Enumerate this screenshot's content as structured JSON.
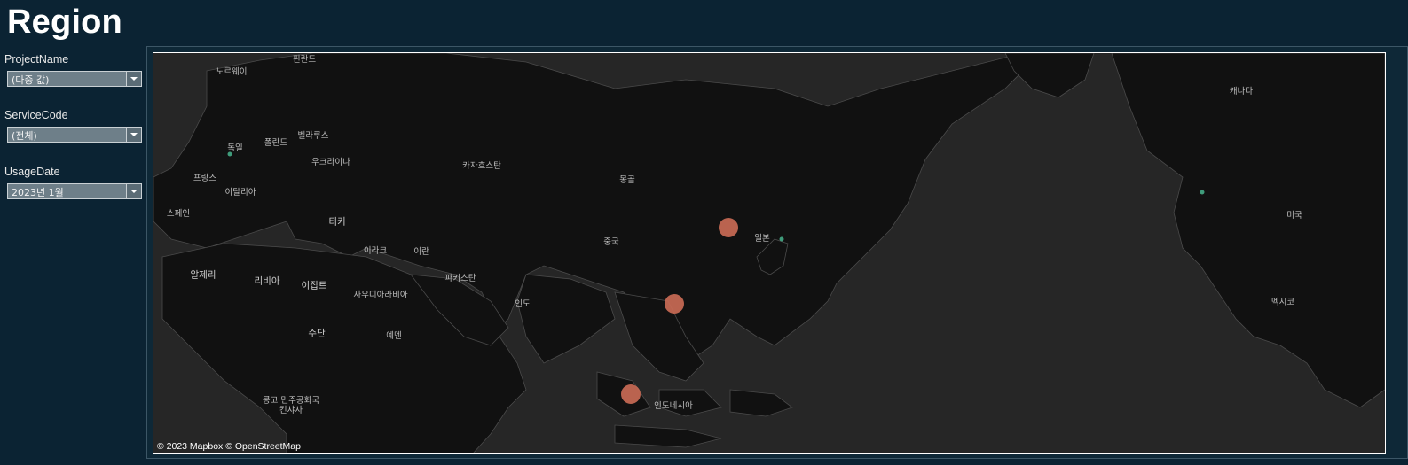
{
  "page": {
    "title": "Region"
  },
  "filters": [
    {
      "label": "ProjectName",
      "value": "(다중 값)"
    },
    {
      "label": "ServiceCode",
      "value": "(전체)"
    },
    {
      "label": "UsageDate",
      "value": "2023년 1월"
    }
  ],
  "map": {
    "attribution": "© 2023 Mapbox © OpenStreetMap",
    "labels": {
      "norway": "노르웨이",
      "finland": "핀란드",
      "canada": "캐나다",
      "germany": "독일",
      "poland": "폴란드",
      "belarus": "벨라루스",
      "ukraine": "우크라이나",
      "kazakhstan": "카자흐스탄",
      "mongolia": "몽골",
      "france": "프랑스",
      "italy": "이탈리아",
      "spain": "스페인",
      "turkey": "티키",
      "iraq": "이라크",
      "iran": "이란",
      "china": "중국",
      "japan": "일본",
      "usa": "미국",
      "algeria": "알제리",
      "libya": "리비아",
      "egypt": "이집트",
      "pakistan": "파키스탄",
      "saudi": "사우디아라비아",
      "india": "인도",
      "sudan": "수단",
      "yemen": "예멘",
      "mexico": "멕시코",
      "drc": "콩고 민주공화국\n킨샤사",
      "indonesia": "인도네시아"
    },
    "marks_color": "#c96a55",
    "marks": [
      "Seoul",
      "Hong Kong",
      "Singapore"
    ]
  }
}
